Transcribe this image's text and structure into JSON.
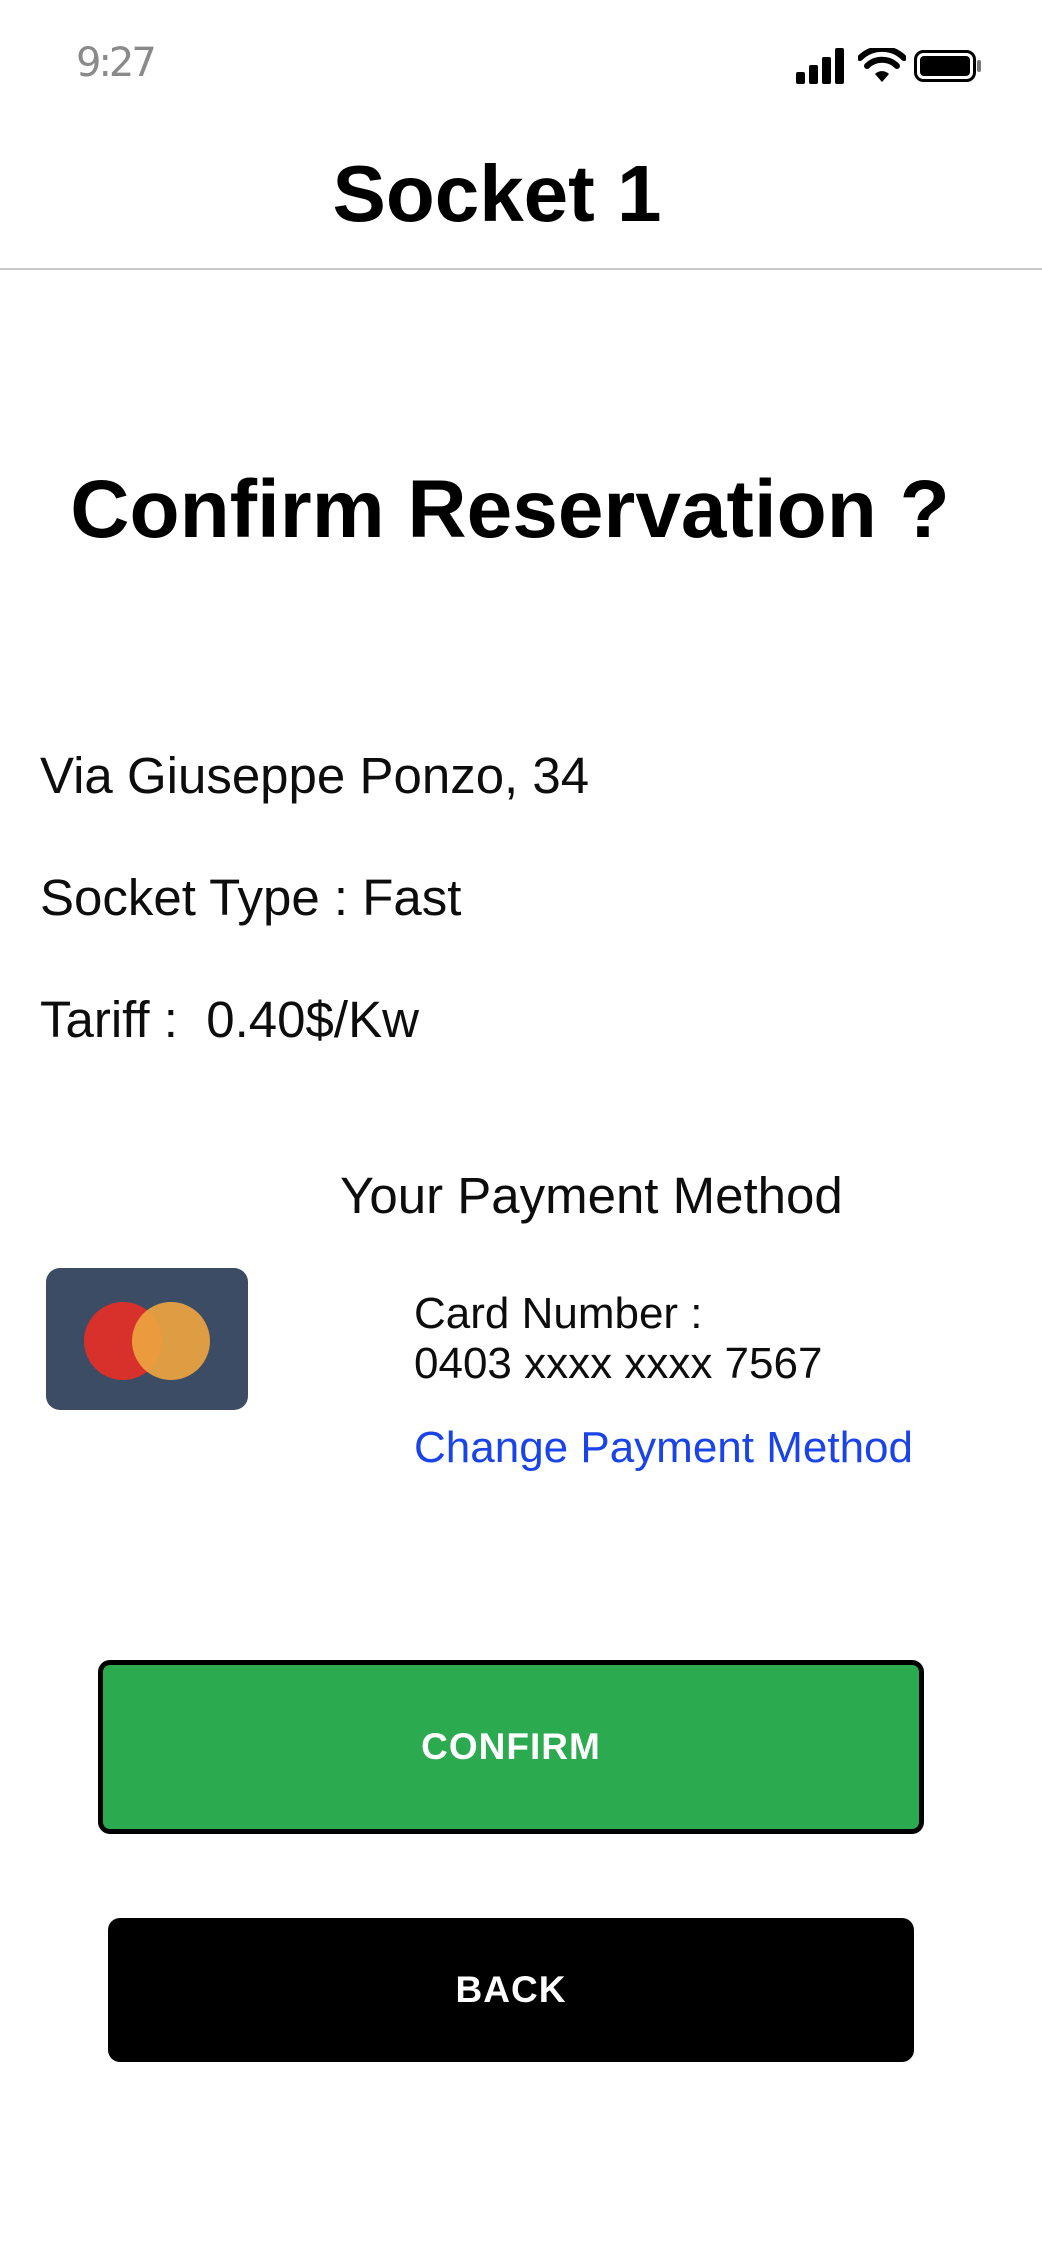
{
  "status_bar": {
    "time": "9:27",
    "icons": [
      "signal-icon",
      "wifi-icon",
      "battery-icon"
    ]
  },
  "header": {
    "title": "Socket 1"
  },
  "main": {
    "heading": "Confirm Reservation ?",
    "address": "Via Giuseppe Ponzo, 34",
    "socket_type": "Socket Type : Fast",
    "tariff": "Tariff :  0.40$/Kw"
  },
  "payment": {
    "heading": "Your Payment Method",
    "card_icon": "mastercard-icon",
    "card_label": "Card Number :",
    "card_number": "0403 xxxx xxxx 7567",
    "change_link": "Change Payment Method"
  },
  "actions": {
    "confirm_label": "CONFIRM",
    "back_label": "BACK"
  },
  "colors": {
    "confirm_green": "#2caa50",
    "link_blue": "#1a44e8",
    "card_background": "#3b4c64",
    "mastercard_red": "#d8312c",
    "mastercard_orange": "#eda440"
  }
}
